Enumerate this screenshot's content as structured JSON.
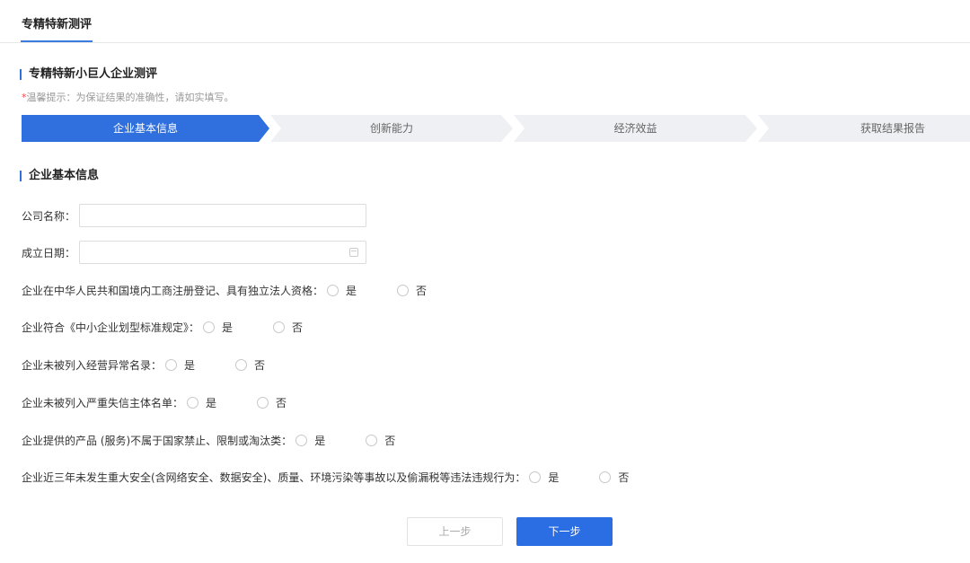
{
  "tab": {
    "label": "专精特新测评"
  },
  "header": {
    "title": "专精特新小巨人企业测评",
    "tip_star": "*",
    "tip_text": "温馨提示：为保证结果的准确性，请如实填写。"
  },
  "steps": [
    {
      "label": "企业基本信息",
      "active": true
    },
    {
      "label": "创新能力",
      "active": false
    },
    {
      "label": "经济效益",
      "active": false
    },
    {
      "label": "获取结果报告",
      "active": false
    }
  ],
  "colors": {
    "accent": "#2b6de3",
    "step_inactive": "#eef0f3",
    "required": "#f0474b"
  },
  "form": {
    "section_title": "企业基本信息",
    "company_name": {
      "label": "公司名称：",
      "value": "",
      "placeholder": ""
    },
    "founded_date": {
      "label": "成立日期：",
      "value": "",
      "placeholder": "",
      "icon": "calendar-icon"
    },
    "questions": [
      {
        "label": "企业在中华人民共和国境内工商注册登记、具有独立法人资格：",
        "yes": "是",
        "no": "否",
        "selected": null
      },
      {
        "label": "企业符合《中小企业划型标准规定》：",
        "yes": "是",
        "no": "否",
        "selected": null
      },
      {
        "label": "企业未被列入经营异常名录：",
        "yes": "是",
        "no": "否",
        "selected": null
      },
      {
        "label": "企业未被列入严重失信主体名单：",
        "yes": "是",
        "no": "否",
        "selected": null
      },
      {
        "label": "企业提供的产品 (服务)不属于国家禁止、限制或淘汰类：",
        "yes": "是",
        "no": "否",
        "selected": null
      },
      {
        "label": "企业近三年未发生重大安全(含网络安全、数据安全)、质量、环境污染等事故以及偷漏税等违法违规行为：",
        "yes": "是",
        "no": "否",
        "selected": null
      }
    ]
  },
  "buttons": {
    "prev": "上一步",
    "next": "下一步"
  }
}
